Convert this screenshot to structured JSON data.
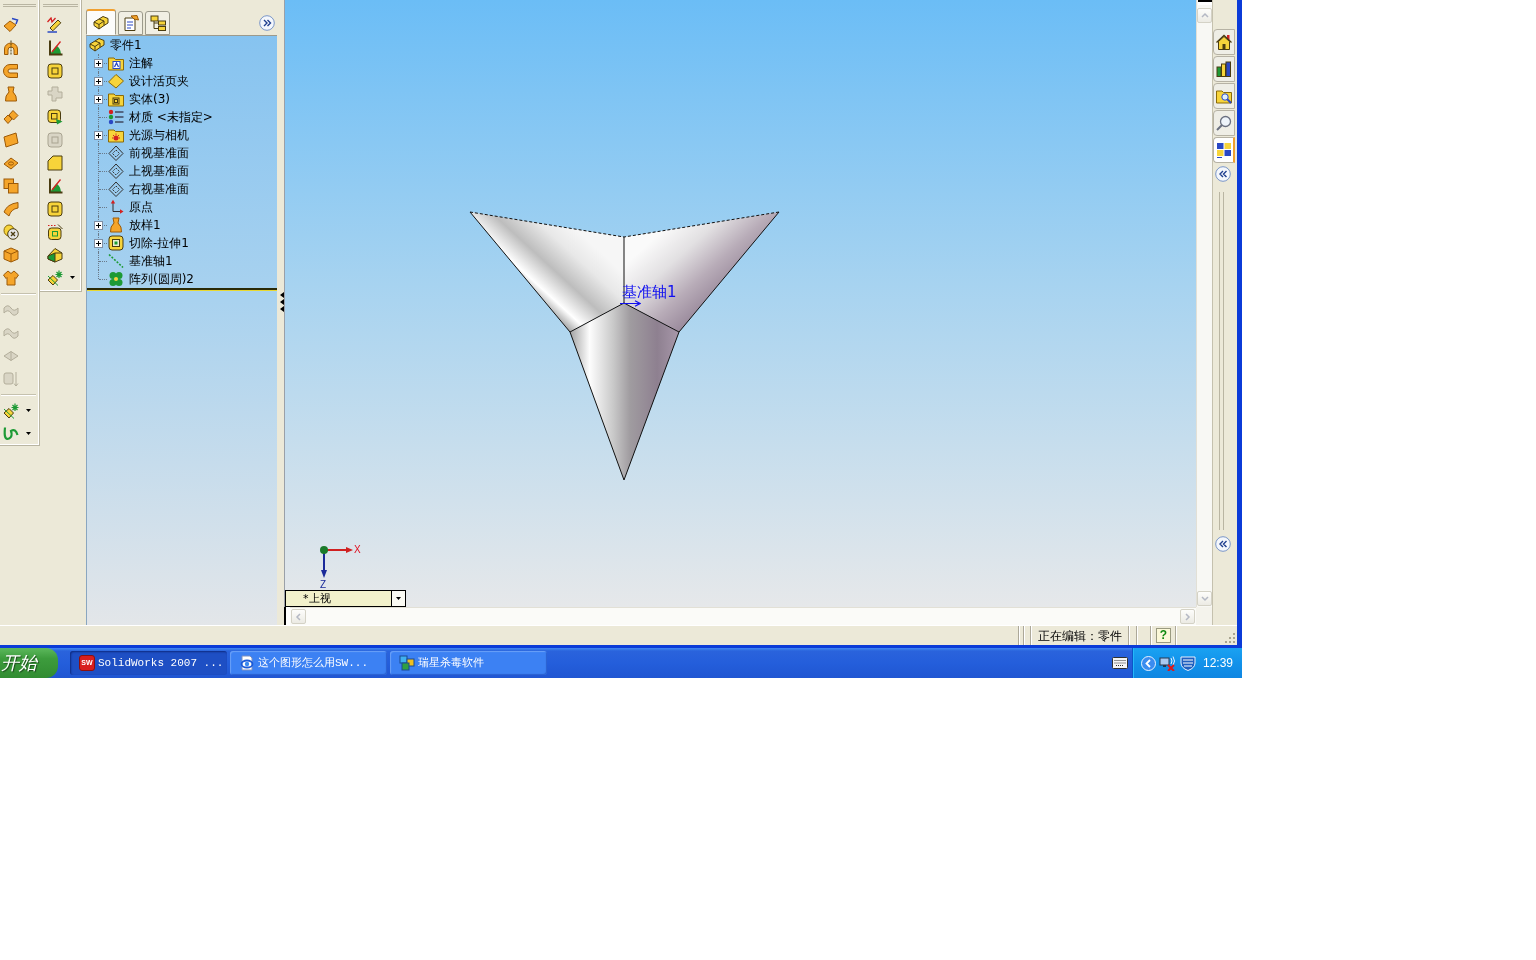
{
  "toolbars": [
    {
      "groups": [
        [
          {
            "kind": "extrude",
            "disabled": false,
            "dropdown": false
          },
          {
            "kind": "revolve",
            "disabled": false,
            "dropdown": false
          },
          {
            "kind": "sweep",
            "disabled": false,
            "dropdown": false
          },
          {
            "kind": "loft",
            "disabled": false,
            "dropdown": false
          },
          {
            "kind": "boundary",
            "disabled": false,
            "dropdown": false
          },
          {
            "kind": "thicken",
            "disabled": false,
            "dropdown": false
          },
          {
            "kind": "surface",
            "disabled": false,
            "dropdown": false
          },
          {
            "kind": "combine",
            "disabled": false,
            "dropdown": false
          },
          {
            "kind": "flex",
            "disabled": false,
            "dropdown": false
          },
          {
            "kind": "deletebody",
            "disabled": false,
            "dropdown": false
          },
          {
            "kind": "cube",
            "disabled": false,
            "dropdown": false
          },
          {
            "kind": "shirt",
            "disabled": false,
            "dropdown": false
          }
        ],
        [
          {
            "kind": "wave",
            "disabled": true,
            "dropdown": false
          },
          {
            "kind": "wave",
            "disabled": true,
            "dropdown": false
          },
          {
            "kind": "book",
            "disabled": true,
            "dropdown": false
          },
          {
            "kind": "boxarrow",
            "disabled": true,
            "dropdown": false
          }
        ],
        [
          {
            "kind": "sparkle",
            "disabled": false,
            "dropdown": true
          },
          {
            "kind": "curve",
            "disabled": false,
            "dropdown": true
          }
        ]
      ]
    },
    {
      "groups": [
        [
          {
            "kind": "sketch3d",
            "disabled": false,
            "dropdown": false
          },
          {
            "kind": "angle",
            "disabled": false,
            "dropdown": false
          },
          {
            "kind": "framed",
            "disabled": false,
            "dropdown": false
          },
          {
            "kind": "grid",
            "disabled": true,
            "dropdown": false
          },
          {
            "kind": "framedplus",
            "disabled": false,
            "dropdown": false
          },
          {
            "kind": "framed",
            "disabled": true,
            "dropdown": false
          },
          {
            "kind": "chamfer",
            "disabled": false,
            "dropdown": false
          },
          {
            "kind": "angle",
            "disabled": false,
            "dropdown": false
          },
          {
            "kind": "framed",
            "disabled": false,
            "dropdown": false
          },
          {
            "kind": "frameddots",
            "disabled": false,
            "dropdown": false
          },
          {
            "kind": "wedge",
            "disabled": false,
            "dropdown": false
          },
          {
            "kind": "sparkle",
            "disabled": false,
            "dropdown": true
          }
        ]
      ]
    }
  ],
  "feature_manager": {
    "tabs": [
      {
        "kind": "features",
        "selected": true
      },
      {
        "kind": "properties",
        "selected": false
      },
      {
        "kind": "configurations",
        "selected": false
      }
    ],
    "tree": {
      "label": "零件1",
      "kind": "part",
      "children": [
        {
          "label": "注解",
          "kind": "annotations",
          "has_children": true
        },
        {
          "label": "设计活页夹",
          "kind": "binder",
          "has_children": true
        },
        {
          "label": "实体(3)",
          "kind": "bodies",
          "has_children": true
        },
        {
          "label": "材质 <未指定>",
          "kind": "material",
          "has_children": false
        },
        {
          "label": "光源与相机",
          "kind": "lights",
          "has_children": true
        },
        {
          "label": "前视基准面",
          "kind": "plane",
          "has_children": false
        },
        {
          "label": "上视基准面",
          "kind": "plane",
          "has_children": false
        },
        {
          "label": "右视基准面",
          "kind": "plane",
          "has_children": false
        },
        {
          "label": "原点",
          "kind": "origin",
          "has_children": false
        },
        {
          "label": "放样1",
          "kind": "loft",
          "has_children": true
        },
        {
          "label": "切除-拉伸1",
          "kind": "cut",
          "has_children": true
        },
        {
          "label": "基准轴1",
          "kind": "axis",
          "has_children": false
        },
        {
          "label": "阵列(圆周)2",
          "kind": "pattern",
          "has_children": false
        }
      ]
    }
  },
  "graphics": {
    "annotation": "基准轴1",
    "triad": {
      "x_label": "X",
      "z_label": "Z"
    },
    "view": "*上视"
  },
  "task_pane": {
    "tabs": [
      {
        "kind": "home",
        "selected": false
      },
      {
        "kind": "library",
        "selected": false
      },
      {
        "kind": "explorer",
        "selected": false
      },
      {
        "kind": "search",
        "selected": false
      },
      {
        "kind": "palette",
        "selected": true
      }
    ]
  },
  "status_bar": {
    "message": "正在编辑：零件",
    "help": "?"
  },
  "taskbar": {
    "start": "开始",
    "buttons": [
      {
        "kind": "app",
        "logo": "SW",
        "label": "SolidWorks 2007 ...",
        "selected": true
      },
      {
        "kind": "browser",
        "label": "这个图形怎么用SW...",
        "selected": false
      },
      {
        "kind": "antivirus",
        "label": "瑞星杀毒软件",
        "selected": false
      }
    ],
    "clock": "12:39"
  }
}
